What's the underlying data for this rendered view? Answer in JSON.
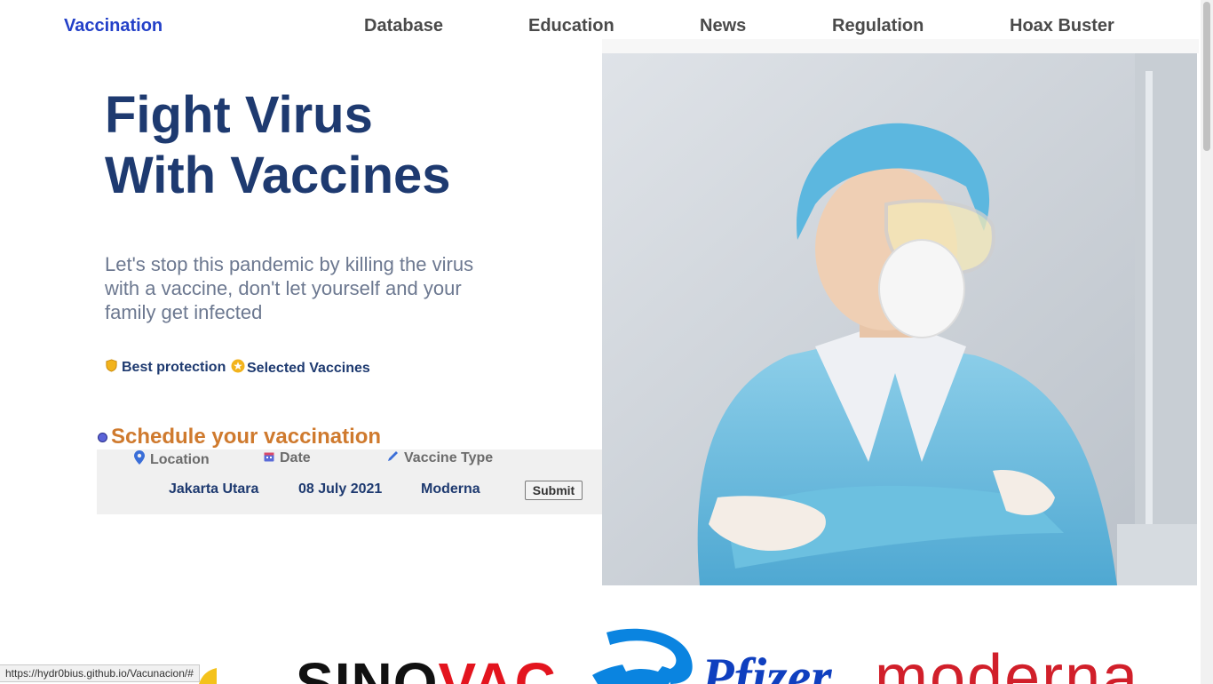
{
  "nav": {
    "brand": "Vaccination",
    "items": [
      {
        "label": "Database"
      },
      {
        "label": "Education"
      },
      {
        "label": "News"
      },
      {
        "label": "Regulation"
      },
      {
        "label": "Hoax Buster"
      }
    ]
  },
  "hero": {
    "title_line1": "Fight Virus",
    "title_line2": "With Vaccines",
    "description": "Let's stop this pandemic by killing the virus with a vaccine, don't let yourself and your family get infected",
    "features": [
      {
        "icon": "shield-icon",
        "label": "Best protection"
      },
      {
        "icon": "star-badge-icon",
        "label": "Selected Vaccines"
      }
    ]
  },
  "schedule": {
    "title": "Schedule your vaccination",
    "fields": [
      {
        "icon": "location-pin-icon",
        "label": "Location",
        "value": "Jakarta Utara"
      },
      {
        "icon": "calendar-icon",
        "label": "Date",
        "value": "08 July 2021"
      },
      {
        "icon": "pencil-icon",
        "label": "Vaccine Type",
        "value": "Moderna"
      }
    ],
    "submit_label": "Submit"
  },
  "logos": {
    "sinovac_part1": "SINO",
    "sinovac_part2": "VAC",
    "pfizer": "Pfizer",
    "moderna": "moderna"
  },
  "status_bar": {
    "url": "https://hydr0bius.github.io/Vacunacion/#"
  },
  "colors": {
    "brand_blue": "#2340c8",
    "heading_navy": "#1e3a70",
    "accent_orange": "#cf7a2e",
    "gown_blue": "#6cc0e0"
  }
}
